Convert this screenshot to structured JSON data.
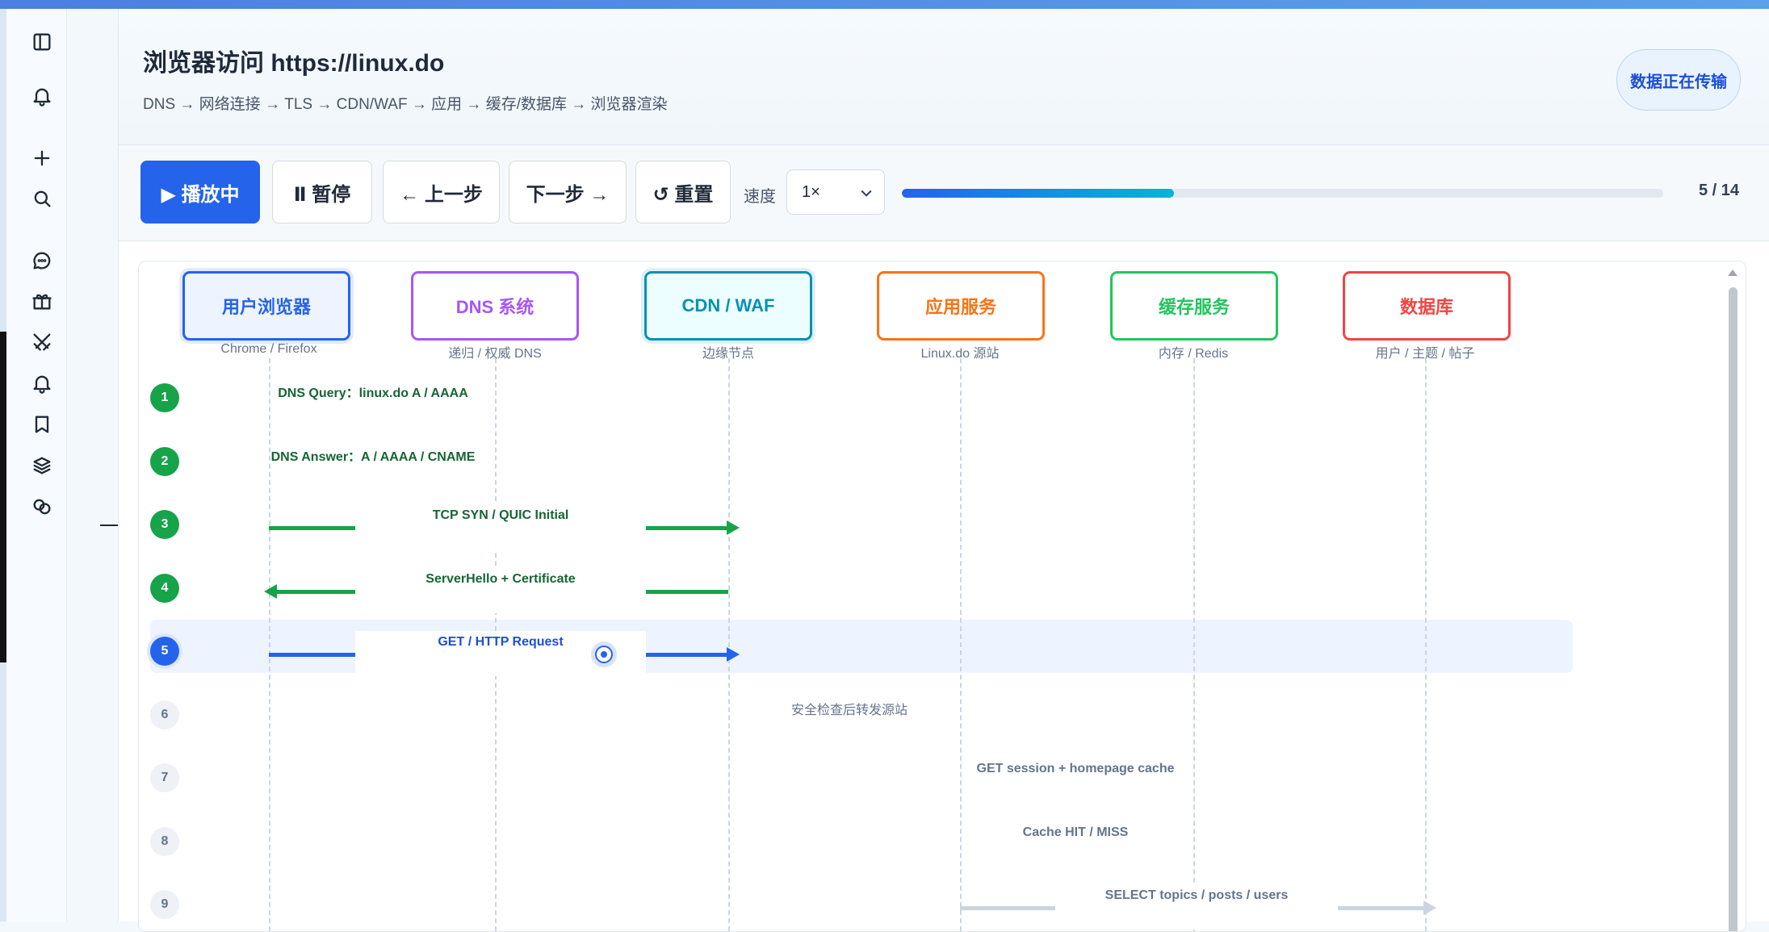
{
  "header": {
    "title": "浏览器访问 https://linux.do",
    "subtitle": "DNS → 网络连接 → TLS → CDN/WAF → 应用 → 缓存/数据库 → 浏览器渲染",
    "status_pill": "数据正在传输"
  },
  "toolbar": {
    "play_label": "▶ 播放中",
    "pause_label": "Ⅱ 暂停",
    "prev_label": "← 上一步",
    "next_label": "下一步 →",
    "reset_label": "↺ 重置",
    "speed_label": "速度",
    "speed_value": "1×",
    "progress_fraction": 0.357,
    "counter": "5 / 14"
  },
  "actors": [
    {
      "name": "用户浏览器",
      "sub": "Chrome / Firefox",
      "color": "#2563eb",
      "bg": "#eef4ff"
    },
    {
      "name": "DNS 系统",
      "sub": "递归 / 权威 DNS",
      "color": "#a855f7",
      "bg": "#ffffff"
    },
    {
      "name": "CDN / WAF",
      "sub": "边缘节点",
      "color": "#0891b2",
      "bg": "#ecfeff"
    },
    {
      "name": "应用服务",
      "sub": "Linux.do 源站",
      "color": "#f97316",
      "bg": "#ffffff"
    },
    {
      "name": "缓存服务",
      "sub": "内存 / Redis",
      "color": "#22c55e",
      "bg": "#ffffff"
    },
    {
      "name": "数据库",
      "sub": "用户 / 主题 / 帖子",
      "color": "#ef4444",
      "bg": "#ffffff"
    }
  ],
  "steps": [
    {
      "num": "1",
      "label": "DNS Query：linux.do A / AAAA",
      "state": "done"
    },
    {
      "num": "2",
      "label": "DNS Answer：A / AAAA / CNAME",
      "state": "done"
    },
    {
      "num": "3",
      "label": "TCP SYN / QUIC Initial",
      "state": "done"
    },
    {
      "num": "4",
      "label": "ServerHello + Certificate",
      "state": "done"
    },
    {
      "num": "5",
      "label": "GET / HTTP Request",
      "state": "active"
    },
    {
      "num": "6",
      "label": "安全检查后转发源站",
      "state": "pending"
    },
    {
      "num": "7",
      "label": "GET session + homepage cache",
      "state": "pending"
    },
    {
      "num": "8",
      "label": "Cache HIT / MISS",
      "state": "pending"
    },
    {
      "num": "9",
      "label": "SELECT topics / posts / users",
      "state": "pending"
    }
  ],
  "colors": {
    "accent": "#2563eb",
    "success": "#16a34a",
    "pending": "#cbd5e1"
  },
  "sidebar_icons": [
    "panel-toggle-icon",
    "bell-icon",
    "plus-icon",
    "search-icon",
    "chat-icon",
    "gift-icon",
    "crossed-swords-icon",
    "bell-icon",
    "bookmark-icon",
    "layers-icon",
    "circles-icon"
  ]
}
